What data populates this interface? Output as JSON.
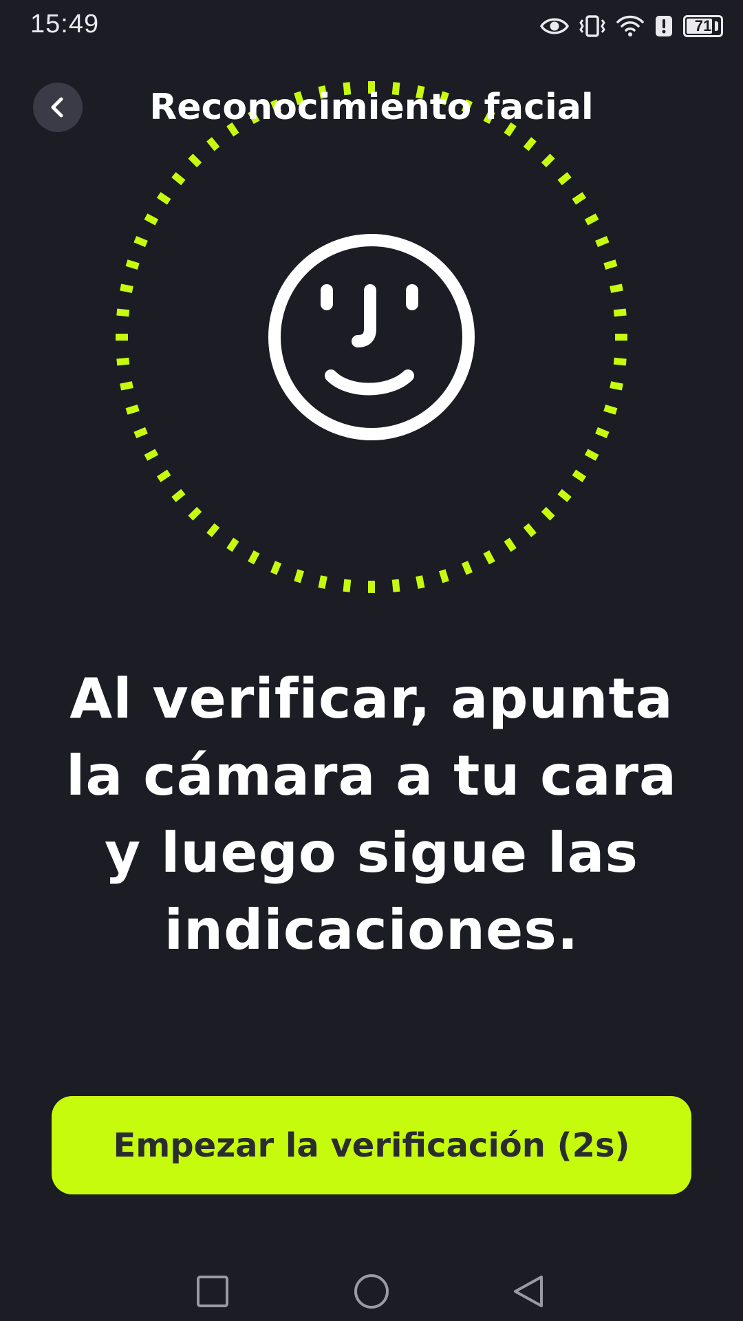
{
  "status_bar": {
    "time": "15:49",
    "battery_level": "71",
    "icons": [
      "eye-icon",
      "vibrate-icon",
      "wifi-icon",
      "alert-icon",
      "battery-icon"
    ]
  },
  "header": {
    "title": "Reconocimiento facial",
    "back_icon": "chevron-left-icon"
  },
  "illustration": {
    "icon": "face-id-icon",
    "ring_color": "#c6fb0e"
  },
  "instruction": {
    "text": "Al verificar, apunta la cámara a tu cara y luego sigue las indicaciones."
  },
  "primary_button": {
    "label": "Empezar la verificación (2s)",
    "color": "#c6fb0e"
  },
  "nav_bar": {
    "items": [
      "recents-icon",
      "home-icon",
      "back-icon"
    ]
  },
  "colors": {
    "background": "#1b1c24",
    "accent": "#c6fb0e",
    "text": "#ffffff"
  }
}
